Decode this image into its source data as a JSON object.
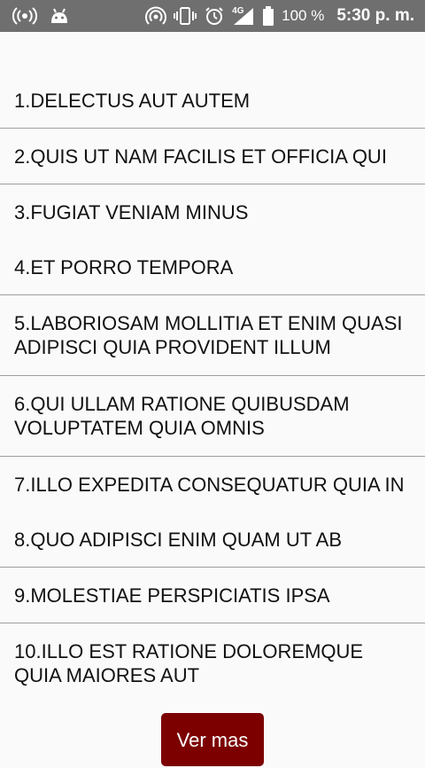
{
  "status_bar": {
    "battery_percent": "100 %",
    "network": "4G",
    "time": "5:30 p. m.",
    "icons": [
      "wireless-broadcast-icon",
      "android-icon",
      "hotspot-icon",
      "vibrate-icon",
      "alarm-icon",
      "signal-icon",
      "battery-icon"
    ]
  },
  "list": {
    "items": [
      {
        "label": "1.DELECTUS AUT AUTEM"
      },
      {
        "label": "2.QUIS UT NAM FACILIS ET OFFICIA QUI"
      },
      {
        "label": "3.FUGIAT VENIAM MINUS"
      },
      {
        "label": "4.ET PORRO TEMPORA"
      },
      {
        "label": "5.LABORIOSAM MOLLITIA ET ENIM QUASI ADIPISCI QUIA PROVIDENT ILLUM"
      },
      {
        "label": "6.QUI ULLAM RATIONE QUIBUSDAM VOLUPTATEM QUIA OMNIS"
      },
      {
        "label": "7.ILLO EXPEDITA CONSEQUATUR QUIA IN"
      },
      {
        "label": "8.QUO ADIPISCI ENIM QUAM UT AB"
      },
      {
        "label": "9.MOLESTIAE PERSPICIATIS IPSA"
      },
      {
        "label": "10.ILLO EST RATIONE DOLOREMQUE QUIA MAIORES AUT"
      }
    ]
  },
  "more_button": {
    "label": "Ver mas",
    "color": "#7c0000"
  }
}
